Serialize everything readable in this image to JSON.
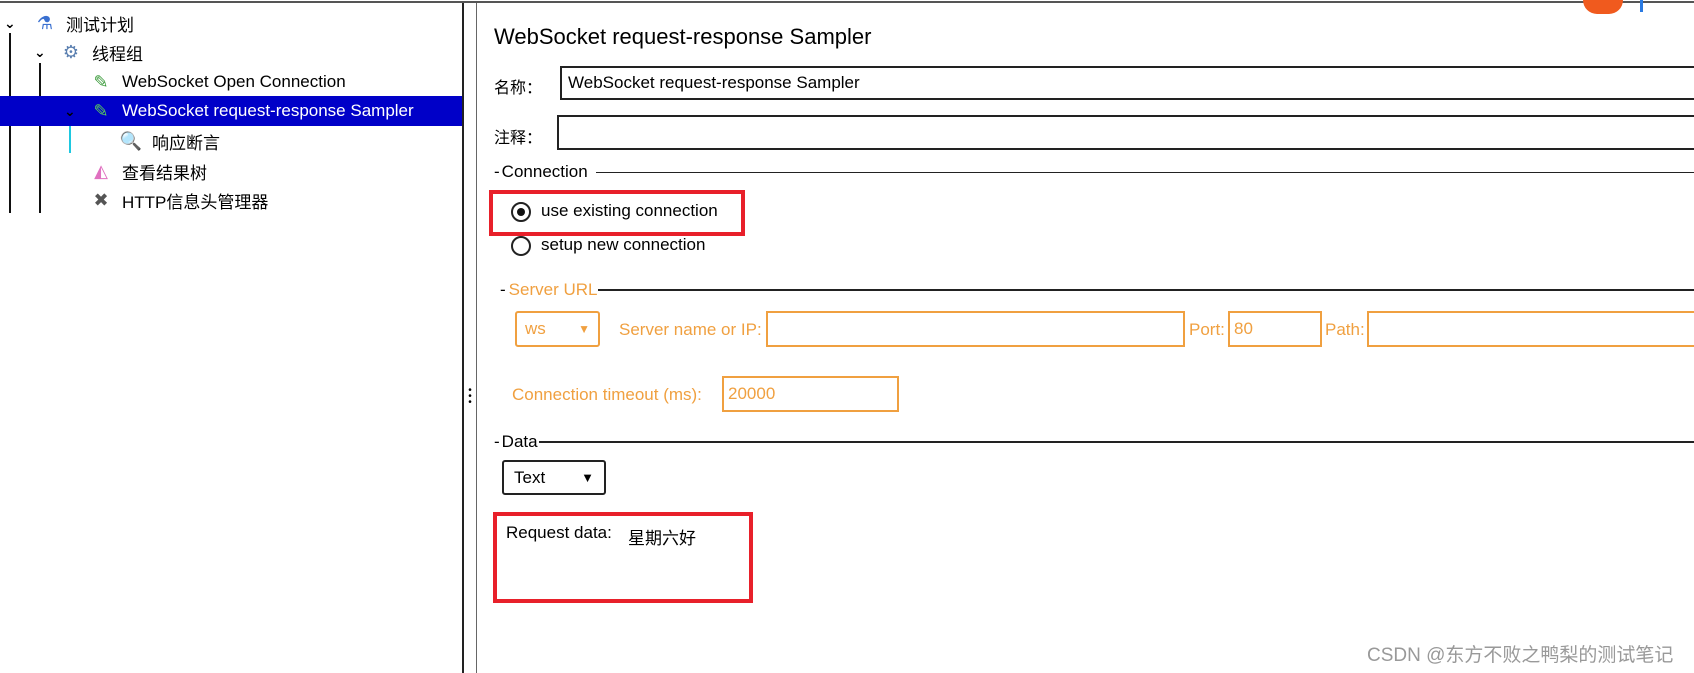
{
  "tree": {
    "items": [
      {
        "label": "测试计划",
        "icon": "flask-icon",
        "expanded": true
      },
      {
        "label": "线程组",
        "icon": "gear-icon",
        "expanded": true
      },
      {
        "label": "WebSocket Open Connection",
        "icon": "pipette-icon"
      },
      {
        "label": "WebSocket request-response Sampler",
        "icon": "pipette-icon",
        "expanded": true,
        "selected": true
      },
      {
        "label": "响应断言",
        "icon": "magnifier-icon"
      },
      {
        "label": "查看结果树",
        "icon": "chart-icon"
      },
      {
        "label": "HTTP信息头管理器",
        "icon": "tools-icon"
      }
    ]
  },
  "panel": {
    "title": "WebSocket request-response Sampler",
    "name_label": "名称：",
    "name_value": "WebSocket request-response Sampler",
    "comment_label": "注释：",
    "comment_value": "",
    "connection": {
      "legend": "Connection",
      "options": [
        "use existing connection",
        "setup new connection"
      ],
      "selected": "use existing connection"
    },
    "server_url": {
      "legend": "Server URL",
      "protocol": "ws",
      "server_label": "Server name or IP:",
      "server_value": "",
      "port_label": "Port:",
      "port_value": "80",
      "path_label": "Path:",
      "path_value": "",
      "timeout_label": "Connection timeout (ms):",
      "timeout_value": "20000"
    },
    "data": {
      "legend": "Data",
      "type": "Text",
      "request_label": "Request data:",
      "request_value": "星期六好"
    }
  },
  "watermark": "CSDN @东方不败之鸭梨的测试笔记",
  "colors": {
    "selection": "#0000c8",
    "disabled_orange": "#f0a040",
    "highlight_red": "#e8202a"
  }
}
